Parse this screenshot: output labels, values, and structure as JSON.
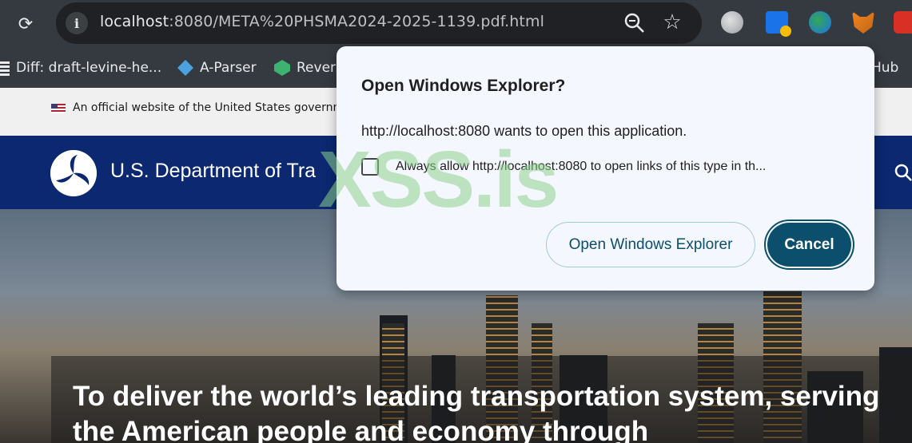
{
  "browser": {
    "url_host": "localhost",
    "url_rest": ":8080/META%20PHSMA2024-2025-1139.pdf.html",
    "icons": [
      "reload-icon",
      "site-info-icon",
      "zoom-icon",
      "bookmark-star-icon",
      "ext-globe-icon",
      "ext-doc-icon",
      "ext-earth-icon",
      "ext-fox-icon",
      "ext-box-icon"
    ]
  },
  "bookmarks": {
    "items": [
      {
        "label": "Diff: draft-levine-he..."
      },
      {
        "label": "A-Parser"
      },
      {
        "label": "Revers"
      },
      {
        "label": "Hub"
      }
    ]
  },
  "page": {
    "gov_banner": "An official website of the United States government",
    "dot_title": "U.S. Department of Tra",
    "hero_heading": "To deliver the world’s leading transportation system, serving the American people and economy through"
  },
  "dialog": {
    "title": "Open Windows Explorer?",
    "message": "http://localhost:8080 wants to open this application.",
    "checkbox_label": "Always allow http://localhost:8080 to open links of this type in th...",
    "checkbox_checked": false,
    "open_label": "Open Windows Explorer",
    "cancel_label": "Cancel"
  },
  "watermark": "XSS.is",
  "colors": {
    "browser_chrome": "#343a40",
    "dot_blue": "#0b2870",
    "dialog_bg": "#f5f7ff",
    "primary_button": "#0b4f6c"
  }
}
